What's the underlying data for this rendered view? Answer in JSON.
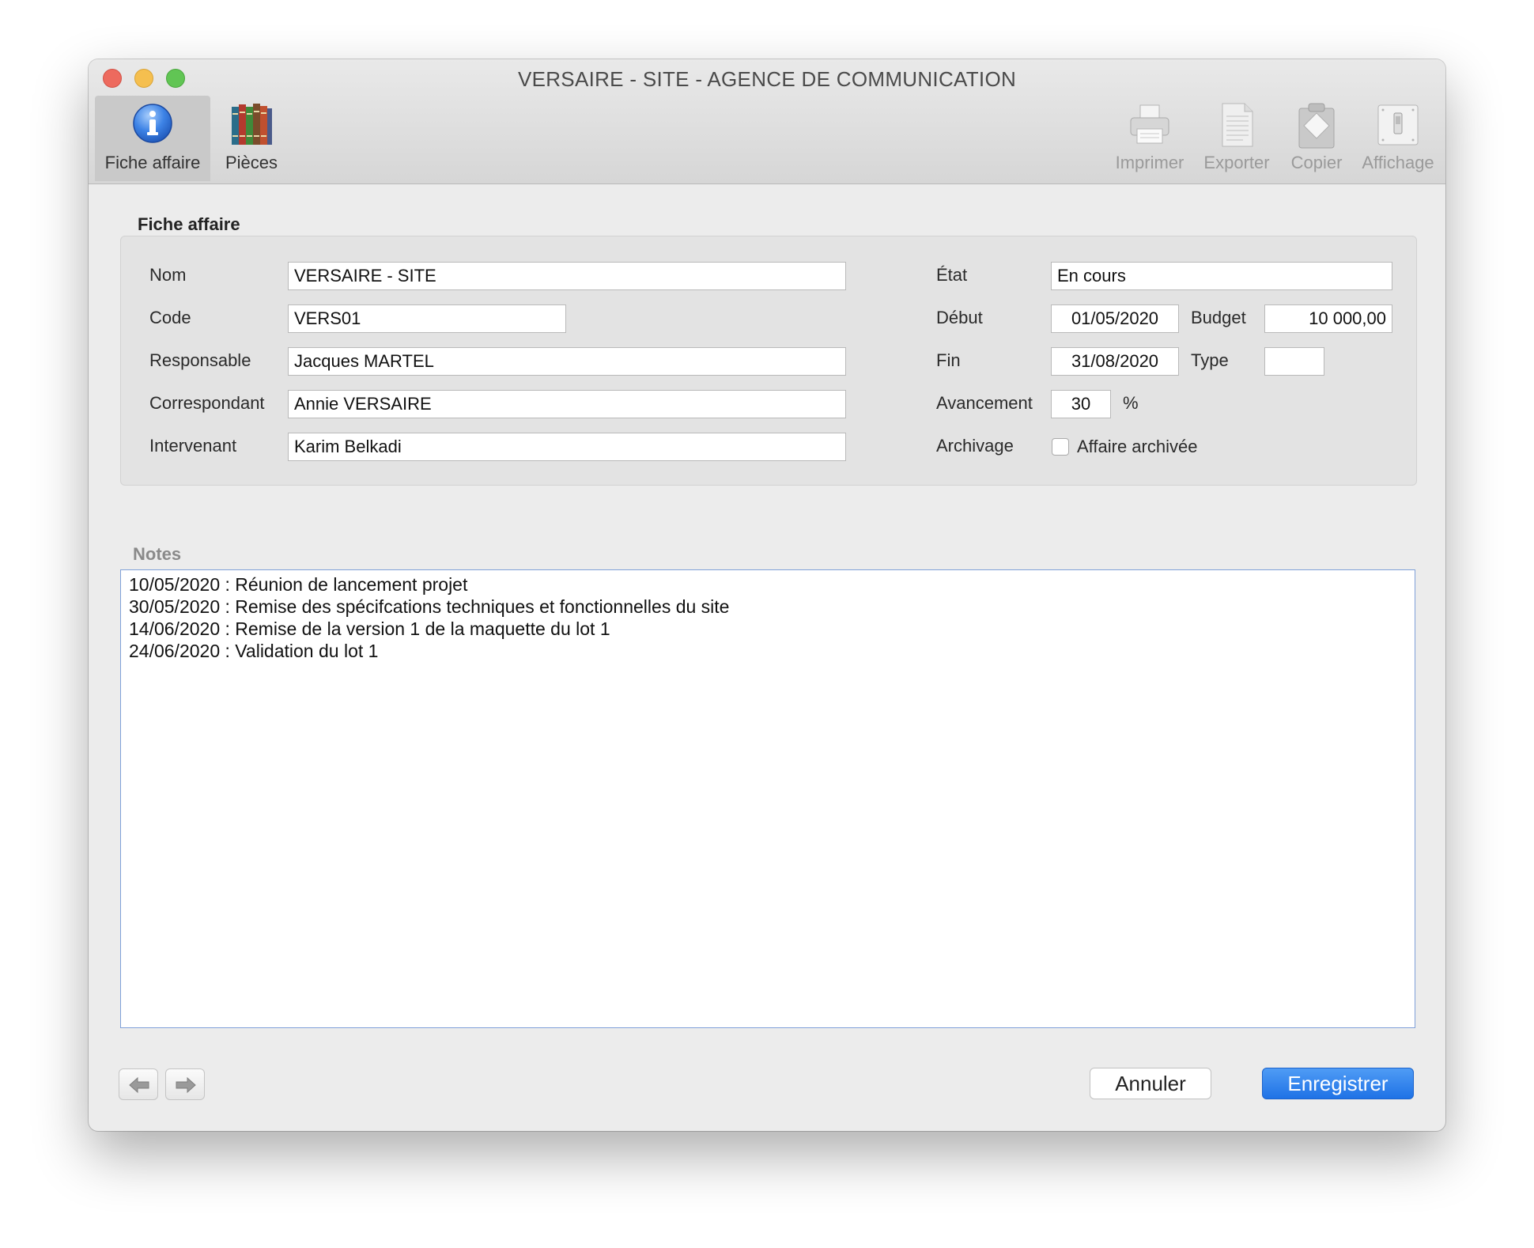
{
  "window": {
    "title": "VERSAIRE - SITE - AGENCE DE COMMUNICATION"
  },
  "toolbar": {
    "left": [
      {
        "label": "Fiche affaire",
        "icon": "info-icon",
        "active": true
      },
      {
        "label": "Pièces",
        "icon": "books-icon"
      }
    ],
    "right": [
      {
        "label": "Imprimer",
        "icon": "printer-icon"
      },
      {
        "label": "Exporter",
        "icon": "export-document-icon"
      },
      {
        "label": "Copier",
        "icon": "clipboard-icon"
      },
      {
        "label": "Affichage",
        "icon": "display-switch-icon"
      }
    ]
  },
  "form": {
    "section_title": "Fiche affaire",
    "nom": {
      "label": "Nom",
      "value": "VERSAIRE - SITE"
    },
    "code": {
      "label": "Code",
      "value": "VERS01"
    },
    "responsable": {
      "label": "Responsable",
      "value": "Jacques MARTEL"
    },
    "correspondant": {
      "label": "Correspondant",
      "value": "Annie VERSAIRE"
    },
    "intervenant": {
      "label": "Intervenant",
      "value": "Karim Belkadi"
    },
    "etat": {
      "label": "État",
      "value": "En cours"
    },
    "debut": {
      "label": "Début",
      "value": "01/05/2020"
    },
    "budget": {
      "label": "Budget",
      "value": "10 000,00"
    },
    "fin": {
      "label": "Fin",
      "value": "31/08/2020"
    },
    "type": {
      "label": "Type",
      "value": ""
    },
    "avancement": {
      "label": "Avancement",
      "value": "30",
      "unit": "%"
    },
    "archivage": {
      "label": "Archivage",
      "checkbox_label": "Affaire archivée",
      "checked": false
    }
  },
  "notes": {
    "label": "Notes",
    "lines": [
      "10/05/2020 : Réunion de lancement projet",
      "30/05/2020 : Remise des spécifcations techniques et fonctionnelles du site",
      "14/06/2020 : Remise de la version 1 de la maquette du lot 1",
      "24/06/2020 : Validation du lot 1"
    ]
  },
  "footer": {
    "cancel_label": "Annuler",
    "save_label": "Enregistrer",
    "prev_icon": "arrow-left-icon",
    "next_icon": "arrow-right-icon"
  },
  "colors": {
    "accent": "#2a7cee",
    "close": "#ed6a5e",
    "minimize": "#f5bf4f",
    "maximize": "#61c554"
  }
}
